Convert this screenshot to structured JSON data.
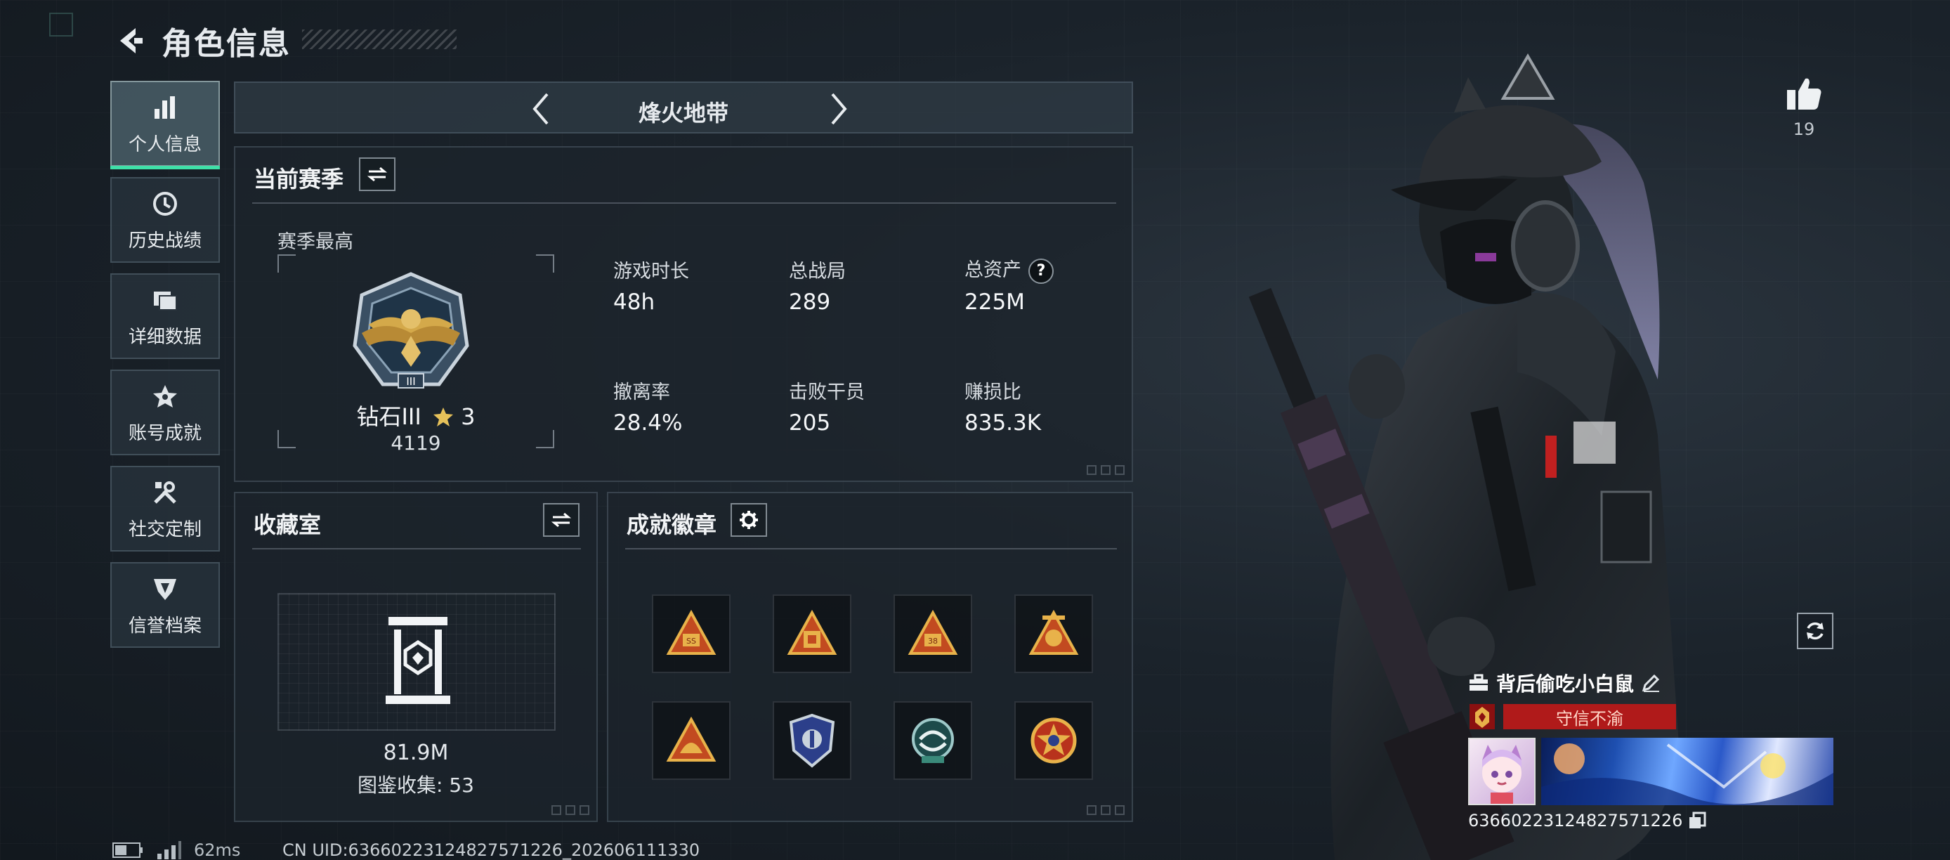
{
  "header": {
    "title": "角色信息"
  },
  "sidebar": {
    "items": [
      {
        "label": "个人信息",
        "icon": "bar-chart-icon",
        "active": true
      },
      {
        "label": "历史战绩",
        "icon": "history-clock-icon",
        "active": false
      },
      {
        "label": "详细数据",
        "icon": "folder-data-icon",
        "active": false
      },
      {
        "label": "账号成就",
        "icon": "achievement-star-icon",
        "active": false
      },
      {
        "label": "社交定制",
        "icon": "tools-icon",
        "active": false
      },
      {
        "label": "信誉档案",
        "icon": "credit-shield-icon",
        "active": false
      }
    ]
  },
  "mode": {
    "label": "烽火地带"
  },
  "season": {
    "title": "当前赛季",
    "highest_label": "赛季最高",
    "rank_name": "钻石III",
    "rank_stars": "3",
    "rank_score": "4119",
    "stats": [
      {
        "label": "游戏时长",
        "value": "48h"
      },
      {
        "label": "总战局",
        "value": "289"
      },
      {
        "label": "总资产",
        "value": "225M",
        "help": "?"
      },
      {
        "label": "撤离率",
        "value": "28.4%"
      },
      {
        "label": "击败干员",
        "value": "205"
      },
      {
        "label": "赚损比",
        "value": "835.3K"
      }
    ]
  },
  "collection": {
    "title": "收藏室",
    "value": "81.9M",
    "collected_label": "图鉴收集: 53"
  },
  "achievement": {
    "title": "成就徽章",
    "badges": [
      "pyramid-badge-icon",
      "pyramid-badge-icon",
      "pyramid-badge-icon",
      "pyramid-badge-icon",
      "pyramid-badge-icon",
      "shield-badge-icon",
      "laurel-badge-icon",
      "star-badge-icon"
    ]
  },
  "status": {
    "ping": "62ms",
    "uid_line": "CN UID:636602231248275712​26_202606111330"
  },
  "likes": {
    "count": "19"
  },
  "player": {
    "name": "背后偷吃小白鼠",
    "honor": "守信不渝",
    "uid": "636602231248275712​26"
  },
  "colors": {
    "accent": "#3fe0a8",
    "honor_red": "#b01a1a",
    "gold": "#d4a94a"
  }
}
